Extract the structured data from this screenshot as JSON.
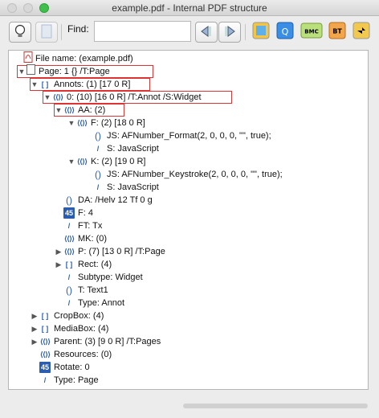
{
  "window": {
    "title": "example.pdf - Internal PDF structure"
  },
  "toolbar": {
    "find_label": "Find:",
    "find_value": "",
    "buttons": [
      {
        "name": "bulb-icon"
      },
      {
        "name": "page-icon"
      },
      {
        "name": "prev-result-icon"
      },
      {
        "name": "next-result-icon"
      },
      {
        "name": "puzzle-icon"
      },
      {
        "name": "puzzle-q-icon",
        "label": "Q"
      },
      {
        "name": "puzzle-bmc-icon",
        "label": "BMC"
      },
      {
        "name": "puzzle-bt-icon",
        "label": "BT"
      },
      {
        "name": "puzzle-arrow-icon"
      }
    ]
  },
  "tree": {
    "rows": [
      {
        "text": "File name: (example.pdf)"
      },
      {
        "text": "Page: 1   {}        /T:Page"
      },
      {
        "text": "Annots:  (1) [17 0 R]"
      },
      {
        "text": "0:  (10) [16 0 R]          /T:Annot  /S:Widget"
      },
      {
        "text": "AA:  (2)"
      },
      {
        "text": "F:  (2) [18 0 R]"
      },
      {
        "text": "JS:   AFNumber_Format(2, 0, 0, 0, \"\", true);"
      },
      {
        "text": "S:   JavaScript"
      },
      {
        "text": "K:  (2) [19 0 R]"
      },
      {
        "text": "JS:   AFNumber_Keystroke(2, 0, 0, 0, \"\", true);"
      },
      {
        "text": "S:   JavaScript"
      },
      {
        "text": "DA:   /Helv 12 Tf 0 g"
      },
      {
        "text": "F:   4"
      },
      {
        "text": "FT:   Tx"
      },
      {
        "text": "MK:   (0)"
      },
      {
        "text": "P:   (7) [13 0 R]       /T:Page"
      },
      {
        "text": "Rect:   (4)"
      },
      {
        "text": "Subtype:   Widget"
      },
      {
        "text": "T:   Text1"
      },
      {
        "text": "Type:   Annot"
      },
      {
        "text": "CropBox:   (4)"
      },
      {
        "text": "MediaBox:   (4)"
      },
      {
        "text": "Parent:   (3) [9 0 R]       /T:Pages"
      },
      {
        "text": "Resources:   (0)"
      },
      {
        "text": "Rotate:   0"
      },
      {
        "text": "Type:   Page"
      }
    ]
  },
  "icons": {
    "array": "[ ]",
    "dict": "⟨⟨⟩⟩",
    "string": "()",
    "number": "45",
    "name": "/"
  }
}
